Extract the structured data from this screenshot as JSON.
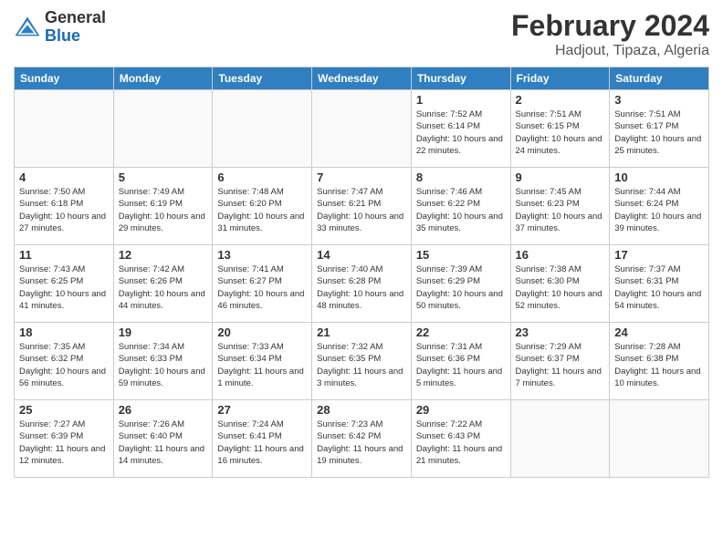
{
  "logo": {
    "general": "General",
    "blue": "Blue"
  },
  "title": "February 2024",
  "subtitle": "Hadjout, Tipaza, Algeria",
  "headers": [
    "Sunday",
    "Monday",
    "Tuesday",
    "Wednesday",
    "Thursday",
    "Friday",
    "Saturday"
  ],
  "weeks": [
    [
      {
        "day": "",
        "info": ""
      },
      {
        "day": "",
        "info": ""
      },
      {
        "day": "",
        "info": ""
      },
      {
        "day": "",
        "info": ""
      },
      {
        "day": "1",
        "info": "Sunrise: 7:52 AM\nSunset: 6:14 PM\nDaylight: 10 hours and 22 minutes."
      },
      {
        "day": "2",
        "info": "Sunrise: 7:51 AM\nSunset: 6:15 PM\nDaylight: 10 hours and 24 minutes."
      },
      {
        "day": "3",
        "info": "Sunrise: 7:51 AM\nSunset: 6:17 PM\nDaylight: 10 hours and 25 minutes."
      }
    ],
    [
      {
        "day": "4",
        "info": "Sunrise: 7:50 AM\nSunset: 6:18 PM\nDaylight: 10 hours and 27 minutes."
      },
      {
        "day": "5",
        "info": "Sunrise: 7:49 AM\nSunset: 6:19 PM\nDaylight: 10 hours and 29 minutes."
      },
      {
        "day": "6",
        "info": "Sunrise: 7:48 AM\nSunset: 6:20 PM\nDaylight: 10 hours and 31 minutes."
      },
      {
        "day": "7",
        "info": "Sunrise: 7:47 AM\nSunset: 6:21 PM\nDaylight: 10 hours and 33 minutes."
      },
      {
        "day": "8",
        "info": "Sunrise: 7:46 AM\nSunset: 6:22 PM\nDaylight: 10 hours and 35 minutes."
      },
      {
        "day": "9",
        "info": "Sunrise: 7:45 AM\nSunset: 6:23 PM\nDaylight: 10 hours and 37 minutes."
      },
      {
        "day": "10",
        "info": "Sunrise: 7:44 AM\nSunset: 6:24 PM\nDaylight: 10 hours and 39 minutes."
      }
    ],
    [
      {
        "day": "11",
        "info": "Sunrise: 7:43 AM\nSunset: 6:25 PM\nDaylight: 10 hours and 41 minutes."
      },
      {
        "day": "12",
        "info": "Sunrise: 7:42 AM\nSunset: 6:26 PM\nDaylight: 10 hours and 44 minutes."
      },
      {
        "day": "13",
        "info": "Sunrise: 7:41 AM\nSunset: 6:27 PM\nDaylight: 10 hours and 46 minutes."
      },
      {
        "day": "14",
        "info": "Sunrise: 7:40 AM\nSunset: 6:28 PM\nDaylight: 10 hours and 48 minutes."
      },
      {
        "day": "15",
        "info": "Sunrise: 7:39 AM\nSunset: 6:29 PM\nDaylight: 10 hours and 50 minutes."
      },
      {
        "day": "16",
        "info": "Sunrise: 7:38 AM\nSunset: 6:30 PM\nDaylight: 10 hours and 52 minutes."
      },
      {
        "day": "17",
        "info": "Sunrise: 7:37 AM\nSunset: 6:31 PM\nDaylight: 10 hours and 54 minutes."
      }
    ],
    [
      {
        "day": "18",
        "info": "Sunrise: 7:35 AM\nSunset: 6:32 PM\nDaylight: 10 hours and 56 minutes."
      },
      {
        "day": "19",
        "info": "Sunrise: 7:34 AM\nSunset: 6:33 PM\nDaylight: 10 hours and 59 minutes."
      },
      {
        "day": "20",
        "info": "Sunrise: 7:33 AM\nSunset: 6:34 PM\nDaylight: 11 hours and 1 minute."
      },
      {
        "day": "21",
        "info": "Sunrise: 7:32 AM\nSunset: 6:35 PM\nDaylight: 11 hours and 3 minutes."
      },
      {
        "day": "22",
        "info": "Sunrise: 7:31 AM\nSunset: 6:36 PM\nDaylight: 11 hours and 5 minutes."
      },
      {
        "day": "23",
        "info": "Sunrise: 7:29 AM\nSunset: 6:37 PM\nDaylight: 11 hours and 7 minutes."
      },
      {
        "day": "24",
        "info": "Sunrise: 7:28 AM\nSunset: 6:38 PM\nDaylight: 11 hours and 10 minutes."
      }
    ],
    [
      {
        "day": "25",
        "info": "Sunrise: 7:27 AM\nSunset: 6:39 PM\nDaylight: 11 hours and 12 minutes."
      },
      {
        "day": "26",
        "info": "Sunrise: 7:26 AM\nSunset: 6:40 PM\nDaylight: 11 hours and 14 minutes."
      },
      {
        "day": "27",
        "info": "Sunrise: 7:24 AM\nSunset: 6:41 PM\nDaylight: 11 hours and 16 minutes."
      },
      {
        "day": "28",
        "info": "Sunrise: 7:23 AM\nSunset: 6:42 PM\nDaylight: 11 hours and 19 minutes."
      },
      {
        "day": "29",
        "info": "Sunrise: 7:22 AM\nSunset: 6:43 PM\nDaylight: 11 hours and 21 minutes."
      },
      {
        "day": "",
        "info": ""
      },
      {
        "day": "",
        "info": ""
      }
    ]
  ]
}
